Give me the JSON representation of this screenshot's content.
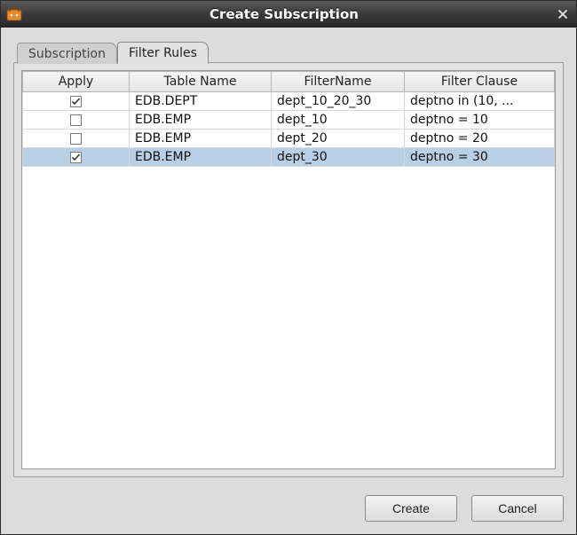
{
  "window": {
    "title": "Create Subscription"
  },
  "tabs": {
    "subscription": {
      "label": "Subscription"
    },
    "filter_rules": {
      "label": "Filter Rules"
    }
  },
  "active_tab": "filter_rules",
  "table": {
    "headers": {
      "apply": "Apply",
      "table_name": "Table Name",
      "filter_name": "FilterName",
      "filter_clause": "Filter Clause"
    },
    "rows": [
      {
        "apply": true,
        "table_name": "EDB.DEPT",
        "filter_name": "dept_10_20_30",
        "filter_clause": "deptno in (10, ...",
        "selected": false
      },
      {
        "apply": false,
        "table_name": "EDB.EMP",
        "filter_name": "dept_10",
        "filter_clause": "deptno = 10",
        "selected": false
      },
      {
        "apply": false,
        "table_name": "EDB.EMP",
        "filter_name": "dept_20",
        "filter_clause": "deptno = 20",
        "selected": false
      },
      {
        "apply": true,
        "table_name": "EDB.EMP",
        "filter_name": "dept_30",
        "filter_clause": "deptno = 30",
        "selected": true
      }
    ]
  },
  "buttons": {
    "create": "Create",
    "cancel": "Cancel"
  }
}
